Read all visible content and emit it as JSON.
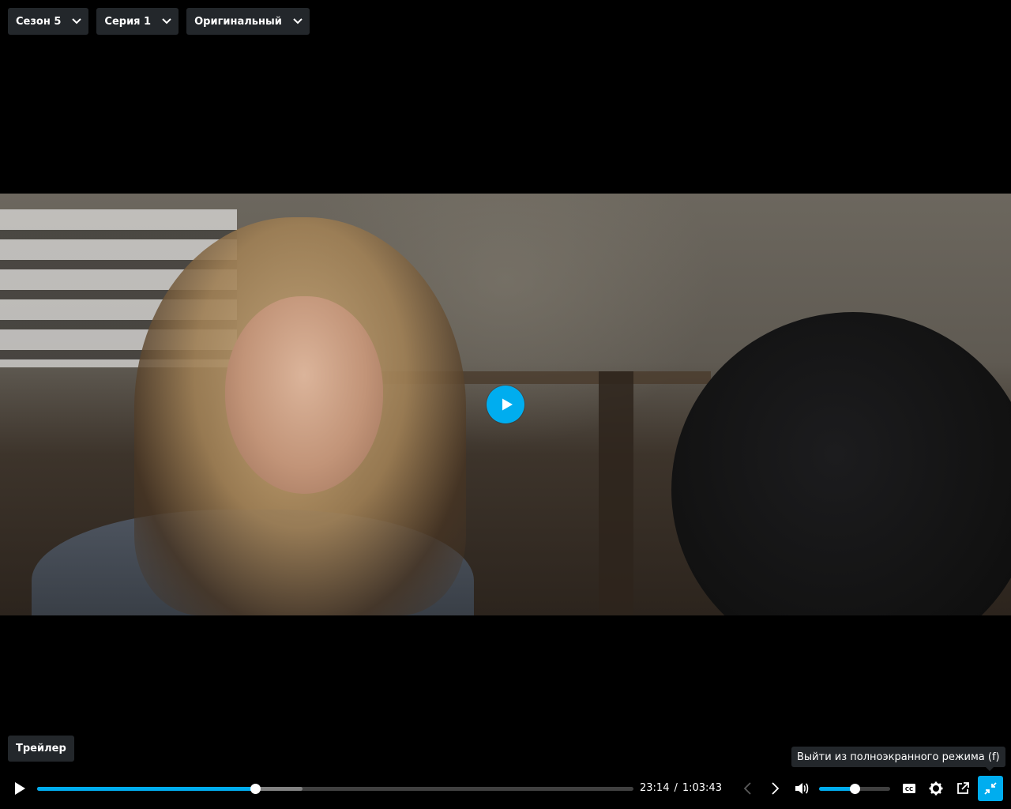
{
  "selectors": {
    "season": "Сезон 5",
    "episode": "Серия 1",
    "audio": "Оригинальный"
  },
  "trailer_label": "Трейлер",
  "tooltip": "Выйти из полноэкранного режима (f)",
  "player": {
    "current_time": "23:14",
    "separator": "/",
    "duration": "1:03:43",
    "progress_fraction": 0.365,
    "buffered_fraction": 0.445,
    "volume_fraction": 0.5
  },
  "colors": {
    "accent": "#00adef",
    "panel": "#23272b",
    "background": "#000000"
  },
  "icons": {
    "play": "play-icon",
    "prev": "chevron-left-icon",
    "next": "chevron-right-icon",
    "volume": "volume-icon",
    "captions": "cc-icon",
    "settings": "gear-icon",
    "popout": "external-link-icon",
    "exit_fullscreen": "exit-fullscreen-icon"
  }
}
